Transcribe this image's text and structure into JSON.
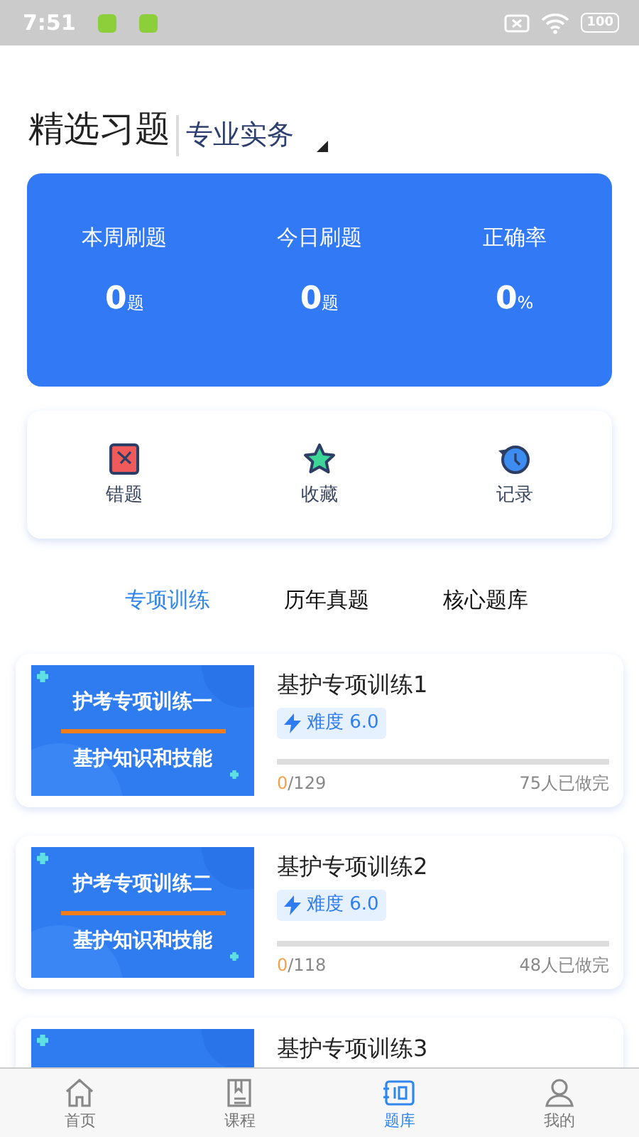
{
  "status_bar": {
    "time": "7:51",
    "battery": "100"
  },
  "header": {
    "title": "精选习题",
    "subject": "专业实务"
  },
  "stats": [
    {
      "label": "本周刷题",
      "value": "0",
      "unit": "题"
    },
    {
      "label": "今日刷题",
      "value": "0",
      "unit": "题"
    },
    {
      "label": "正确率",
      "value": "0",
      "unit": "%"
    }
  ],
  "shortcuts": [
    {
      "kind": "wrong",
      "label": "错题"
    },
    {
      "kind": "favorite",
      "label": "收藏"
    },
    {
      "kind": "history",
      "label": "记录"
    }
  ],
  "tabs": [
    {
      "label": "专项训练",
      "selected": true
    },
    {
      "label": "历年真题",
      "selected": false
    },
    {
      "label": "核心题库",
      "selected": false
    }
  ],
  "courses": [
    {
      "cover_title": "护考专项训练一",
      "cover_subtitle": "基护知识和技能",
      "title": "基护专项训练1",
      "difficulty": "难度 6.0",
      "done": "0",
      "total": "/129",
      "level": 0,
      "finished": "75人已做完"
    },
    {
      "cover_title": "护考专项训练二",
      "cover_subtitle": "基护知识和技能",
      "title": "基护专项训练2",
      "difficulty": "难度 6.0",
      "done": "0",
      "total": "/118",
      "level": 0,
      "finished": "48人已做完"
    },
    {
      "title": "基护专项训练3"
    }
  ],
  "nav": [
    {
      "kind": "home",
      "label": "首页",
      "selected": false
    },
    {
      "kind": "course",
      "label": "课程",
      "selected": false
    },
    {
      "kind": "bank",
      "label": "题库",
      "selected": true
    },
    {
      "kind": "me",
      "label": "我的",
      "selected": false
    }
  ]
}
